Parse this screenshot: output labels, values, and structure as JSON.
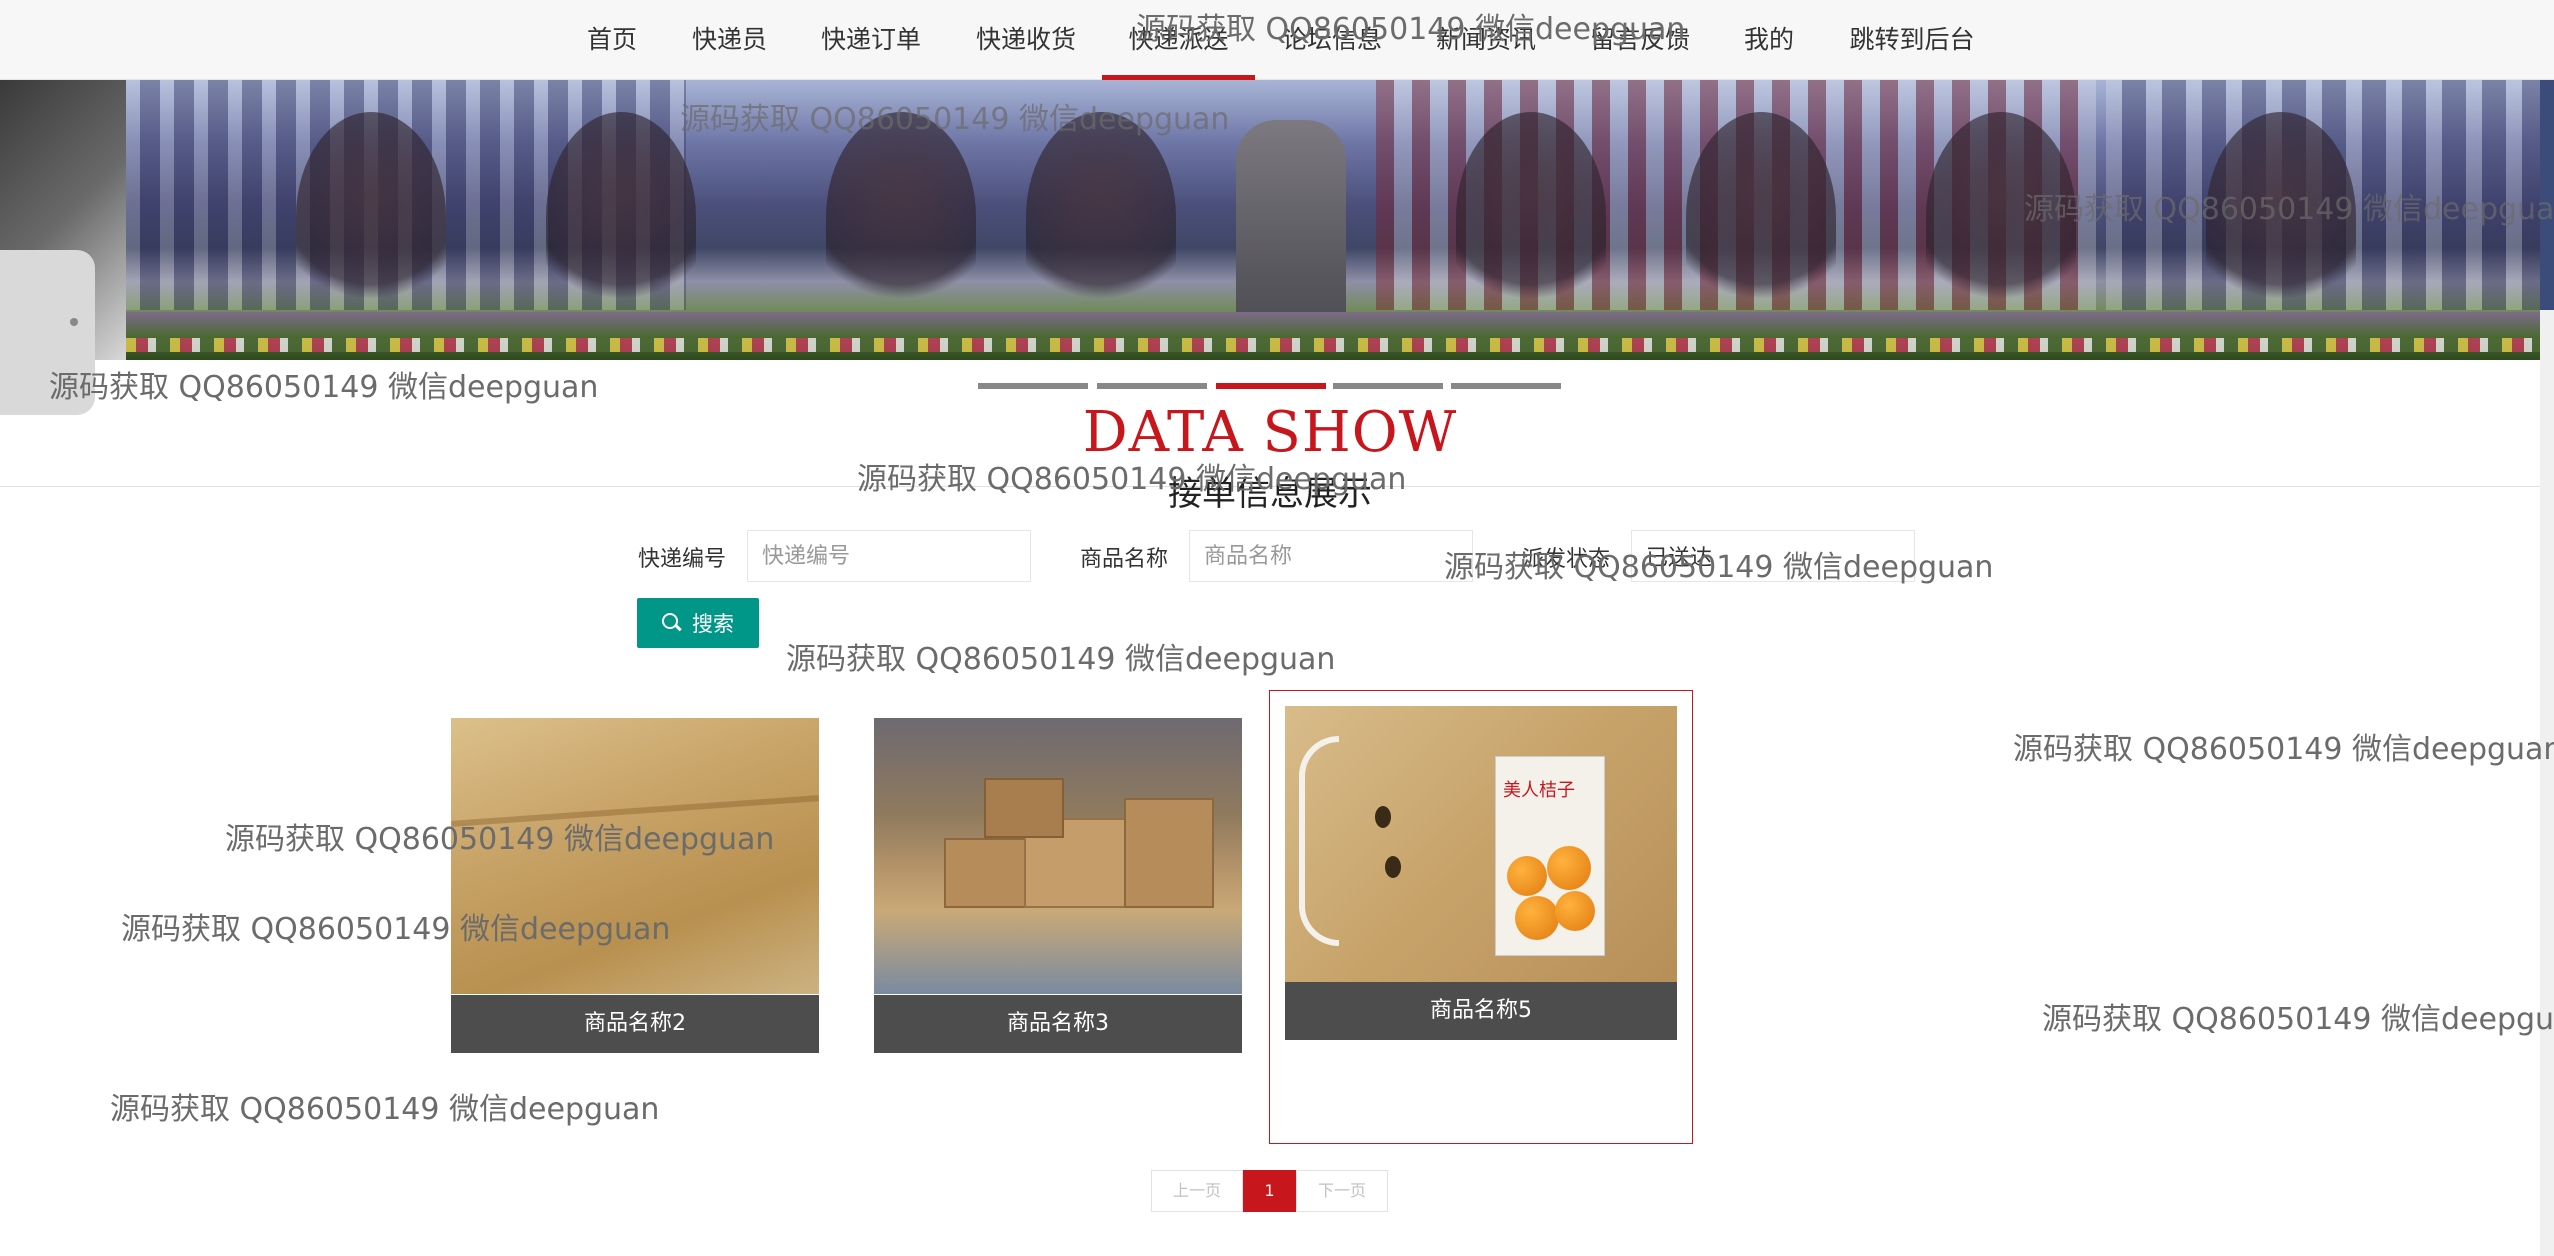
{
  "nav": {
    "items": [
      {
        "label": "首页"
      },
      {
        "label": "快递员"
      },
      {
        "label": "快递订单"
      },
      {
        "label": "快递收货"
      },
      {
        "label": "快递派送"
      },
      {
        "label": "论坛信息"
      },
      {
        "label": "新闻资讯"
      },
      {
        "label": "留言反馈"
      },
      {
        "label": "我的"
      },
      {
        "label": "跳转到后台"
      }
    ],
    "active_index": 4
  },
  "banner": {
    "slide_count": 5,
    "active_slide": 3
  },
  "heading": {
    "title_en": "DATA SHOW",
    "title_cn": "接单信息展示"
  },
  "search": {
    "courier_no_label": "快递编号",
    "courier_no_placeholder": "快递编号",
    "product_name_label": "商品名称",
    "product_name_placeholder": "商品名称",
    "status_label": "派发状态",
    "status_value": "已送达",
    "button_label": "搜索"
  },
  "cards": [
    {
      "name": "商品名称2"
    },
    {
      "name": "商品名称3"
    },
    {
      "name": "商品名称5",
      "image_text": "美人桔子"
    }
  ],
  "pagination": {
    "prev": "上一页",
    "current": "1",
    "next": "下一页"
  },
  "watermark": "源码获取 QQ86050149 微信deepguan",
  "colors": {
    "accent": "#c8161d",
    "search_button": "#009688",
    "caption_bg": "#4d4d4d"
  }
}
